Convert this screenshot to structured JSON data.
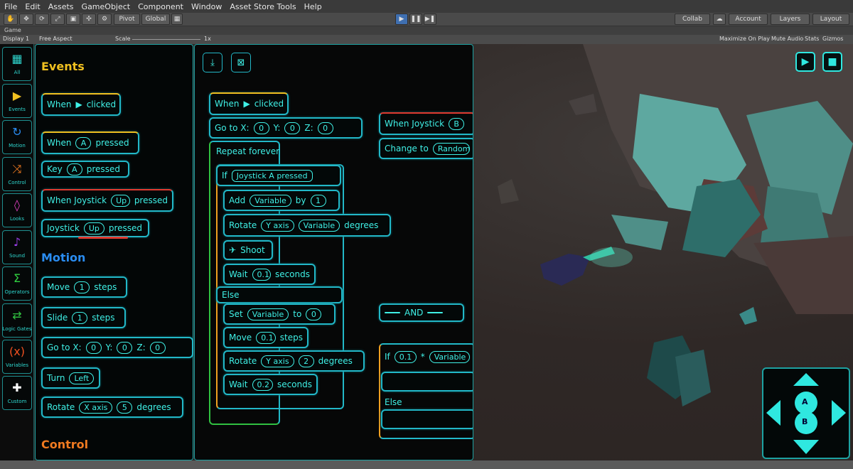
{
  "menu": [
    "File",
    "Edit",
    "Assets",
    "GameObject",
    "Component",
    "Window",
    "Asset Store Tools",
    "Help"
  ],
  "toolbar": {
    "pivot": "Pivot",
    "global": "Global",
    "collab": "Collab",
    "account": "Account",
    "layers": "Layers",
    "layout": "Layout"
  },
  "game_tab": "Game",
  "game_options": {
    "display": "Display 1",
    "aspect": "Free Aspect",
    "scale_label": "Scale",
    "scale_value": "1x",
    "maximize": "Maximize On Play",
    "mute": "Mute Audio",
    "stats": "Stats",
    "gizmos": "Gizmos"
  },
  "categories": [
    {
      "label": "All",
      "icon": "grid",
      "color": "#2fd8d0"
    },
    {
      "label": "Events",
      "icon": "play",
      "color": "#f0c020"
    },
    {
      "label": "Motion",
      "icon": "rotate",
      "color": "#2a8cf0"
    },
    {
      "label": "Control",
      "icon": "shuffle",
      "color": "#f07a20"
    },
    {
      "label": "Looks",
      "icon": "drop",
      "color": "#e040c0"
    },
    {
      "label": "Sound",
      "icon": "note",
      "color": "#a040f0"
    },
    {
      "label": "Operators",
      "icon": "sigma",
      "color": "#30d040"
    },
    {
      "label": "Logic Gates",
      "icon": "cycle",
      "color": "#30c040"
    },
    {
      "label": "Variables",
      "icon": "x",
      "color": "#f05020"
    },
    {
      "label": "Custom",
      "icon": "plus",
      "color": "#ffffff"
    }
  ],
  "palette": {
    "events_title": "Events",
    "motion_title": "Motion",
    "control_title": "Control",
    "when": "When",
    "clicked": "clicked",
    "pressed": "pressed",
    "key": "Key",
    "a": "A",
    "when_joystick": "When Joystick",
    "joystick": "Joystick",
    "up": "Up",
    "move": "Move",
    "steps": "steps",
    "slide": "Slide",
    "one": "1",
    "goto": "Go to X:",
    "y": "Y:",
    "z": "Z:",
    "zero": "0",
    "turn": "Turn",
    "left": "Left",
    "rotate": "Rotate",
    "xaxis": "X axis",
    "five": "5",
    "degrees": "degrees"
  },
  "script": {
    "when": "When",
    "clicked": "clicked",
    "goto": "Go to X:",
    "y": "Y:",
    "z": "Z:",
    "zero": "0",
    "repeat": "Repeat forever",
    "if": "If",
    "joystick": "Joystick",
    "a": "A",
    "pressed": "pressed",
    "add": "Add",
    "variable": "Variable",
    "by": "by",
    "one": "1",
    "rotate": "Rotate",
    "yaxis": "Y axis",
    "degrees": "degrees",
    "shoot": "Shoot",
    "wait": "Wait",
    "p1": "0.1",
    "seconds": "seconds",
    "else": "Else",
    "set": "Set",
    "to": "to",
    "move": "Move",
    "steps": "steps",
    "two": "2",
    "p2": "0.2",
    "when_joystick": "When Joystick",
    "b": "B",
    "change": "Change to",
    "random": "Random",
    "and": "AND",
    "star": "*"
  },
  "gamepad": {
    "a": "A",
    "b": "B"
  }
}
